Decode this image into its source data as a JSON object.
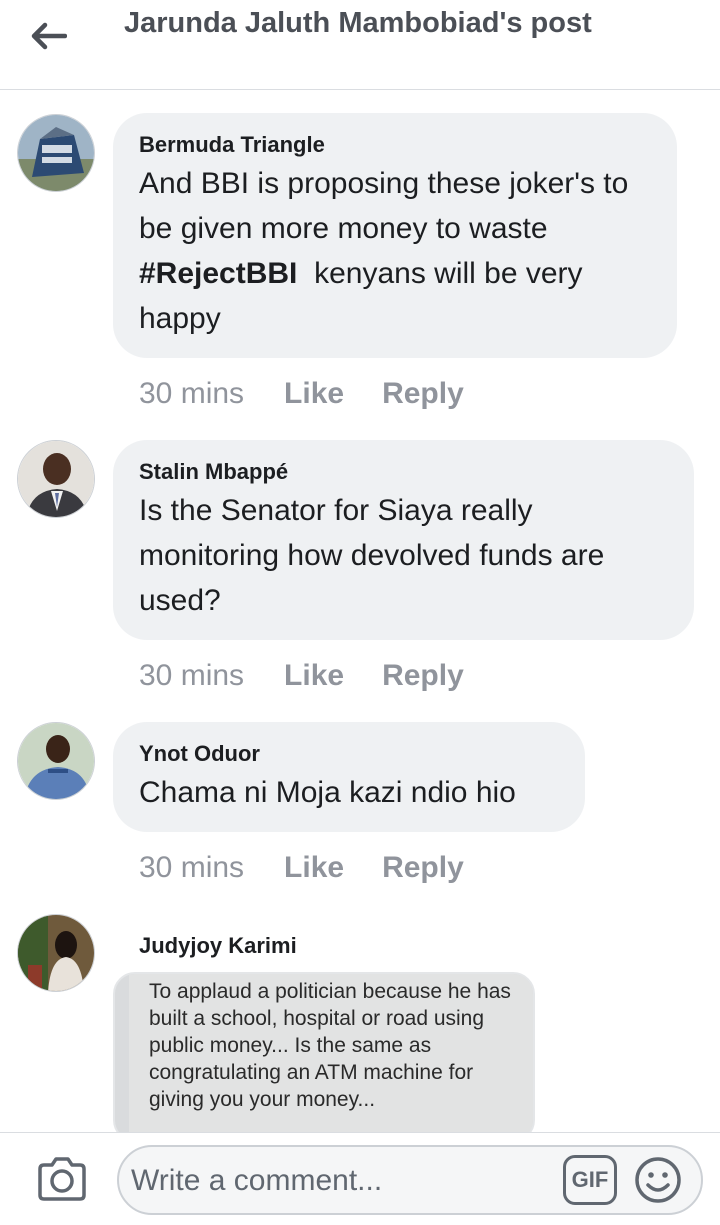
{
  "header": {
    "title": "Jarunda Jaluth Mambobiad's post"
  },
  "comments": [
    {
      "author": "Bermuda Triangle",
      "text_before": "And BBI is proposing these joker's to be given more money to waste ",
      "hashtag": "#RejectBBI",
      "text_after": "  kenyans will be very happy",
      "time": "30 mins",
      "like": "Like",
      "reply": "Reply"
    },
    {
      "author": "Stalin Mbappé",
      "text": "Is the Senator for Siaya really monitoring how devolved funds are used?",
      "time": "30 mins",
      "like": "Like",
      "reply": "Reply"
    },
    {
      "author": "Ynot Oduor",
      "text": "Chama ni Moja kazi ndio hio",
      "time": "30 mins",
      "like": "Like",
      "reply": "Reply"
    },
    {
      "author": "Judyjoy Karimi",
      "image_lines": [
        "To applaud a politician because he has",
        "built a school, hospital or road using",
        "public money... Is the same as",
        "congratulating an ATM machine for",
        "giving you your money..."
      ]
    }
  ],
  "composer": {
    "placeholder": "Write a comment...",
    "gif_label": "GIF"
  },
  "icons": {
    "back": "arrow-left-icon",
    "camera": "camera-icon",
    "emoji": "smiley-icon"
  }
}
